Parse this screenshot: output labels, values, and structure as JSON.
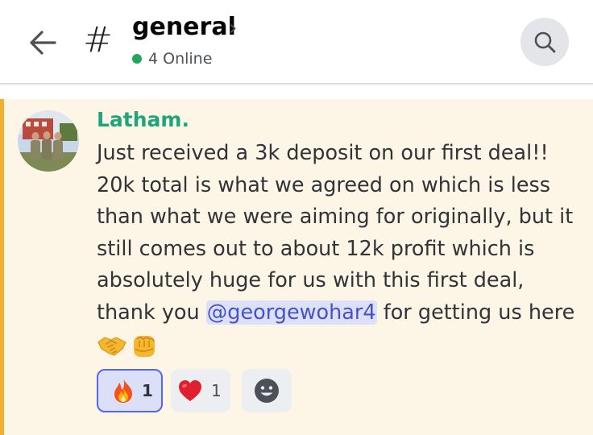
{
  "header": {
    "channel_symbol": "#",
    "channel_name": "general",
    "chevron": "›",
    "online_text": "4 Online",
    "back_icon": "arrow-left-icon",
    "search_icon": "search-icon"
  },
  "message": {
    "author": "Latham.",
    "text_before": "Just received a 3k deposit on our first deal!! 20k total is what we agreed on which is less than what we were aiming for originally, but it still comes out to about 12k profit which is absolutely huge for us with this first deal, thank you ",
    "mention": "@georgewohar4",
    "text_after": " for getting us here",
    "inline_emojis": [
      "handshake-emoji",
      "fist-bump-emoji"
    ]
  },
  "reactions": [
    {
      "emoji": "fire-emoji",
      "count": "1",
      "selected": true
    },
    {
      "emoji": "red-heart-emoji",
      "count": "1",
      "selected": false
    },
    {
      "emoji": "add-reaction-icon",
      "count": null,
      "selected": false
    }
  ],
  "colors": {
    "online_dot": "#23a55a",
    "author": "#1fa57c",
    "mention_highlight_bg": "#fdf6e7",
    "mention_bar": "#f0b132",
    "mention_text": "#4752c4",
    "reaction_selected_border": "#5865f2"
  }
}
